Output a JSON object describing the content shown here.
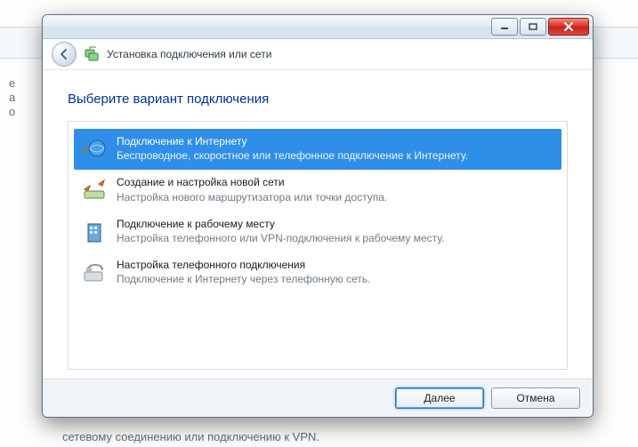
{
  "window": {
    "header_title": "Установка подключения или сети"
  },
  "body": {
    "instruction": "Выберите вариант подключения",
    "options": [
      {
        "title": "Подключение к Интернету",
        "desc": "Беспроводное, скоростное или телефонное подключение к Интернету.",
        "selected": true
      },
      {
        "title": "Создание и настройка новой сети",
        "desc": "Настройка нового маршрутизатора или точки доступа."
      },
      {
        "title": "Подключение к рабочему месту",
        "desc": "Настройка телефонного или VPN-подключения к рабочему месту."
      },
      {
        "title": "Настройка телефонного подключения",
        "desc": "Подключение к Интернету через телефонную сеть."
      }
    ]
  },
  "footer": {
    "next": "Далее",
    "cancel": "Отмена"
  },
  "background": {
    "txt_e": "е",
    "txt_a": "а",
    "txt_o": "о",
    "bottom": "сетевому соединению или подключению к VPN."
  }
}
